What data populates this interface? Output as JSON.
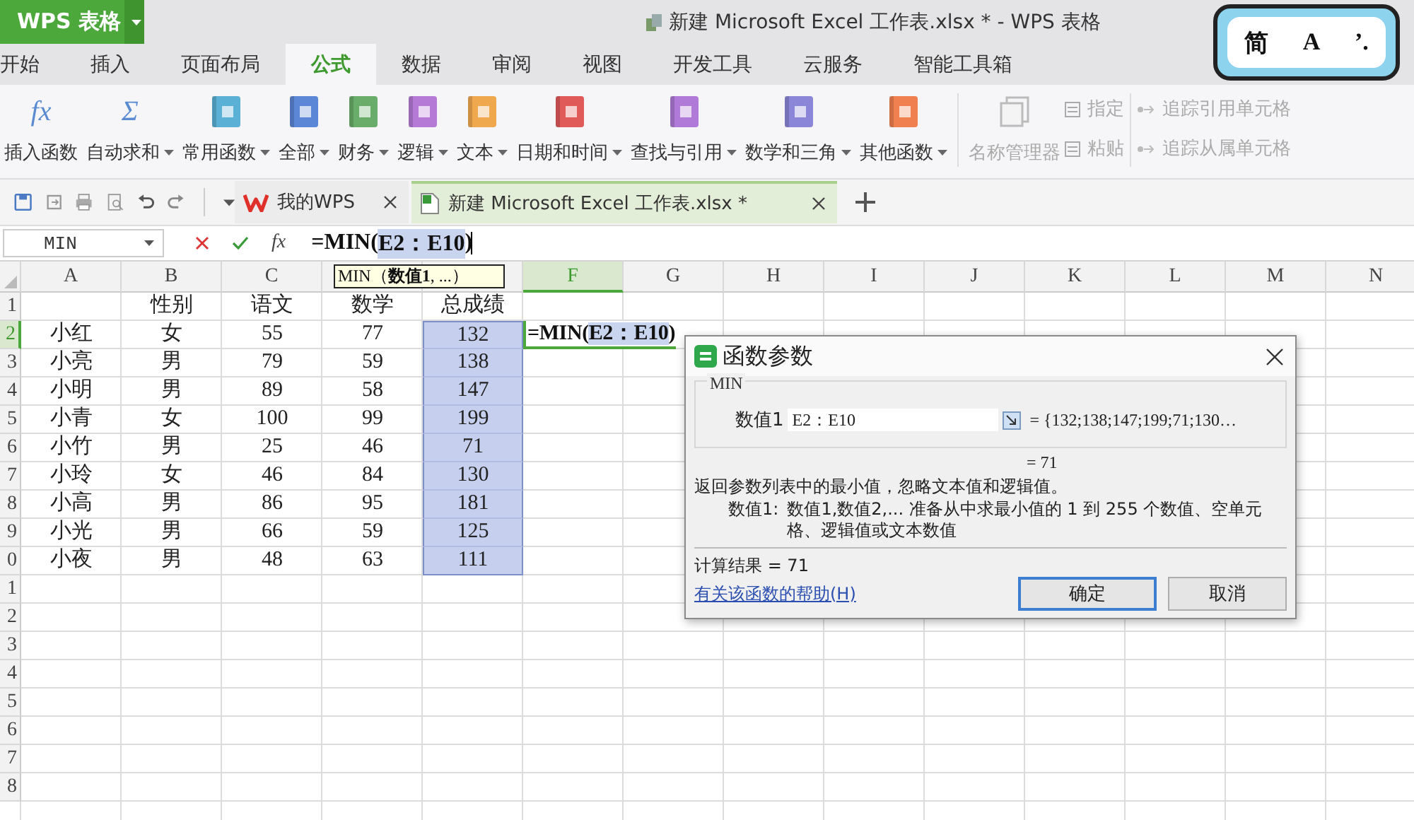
{
  "app_button": {
    "label": "WPS 表格"
  },
  "window": {
    "title": "新建 Microsoft Excel 工作表.xlsx * - WPS 表格"
  },
  "ime_status": {
    "items": [
      "简",
      "A",
      "’."
    ]
  },
  "menu_tabs": [
    {
      "label": "开始",
      "selected": false
    },
    {
      "label": "插入",
      "selected": false
    },
    {
      "label": "页面布局",
      "selected": false
    },
    {
      "label": "公式",
      "selected": true
    },
    {
      "label": "数据",
      "selected": false
    },
    {
      "label": "审阅",
      "selected": false
    },
    {
      "label": "视图",
      "selected": false
    },
    {
      "label": "开发工具",
      "selected": false
    },
    {
      "label": "云服务",
      "selected": false
    },
    {
      "label": "智能工具箱",
      "selected": false
    }
  ],
  "ribbon_buttons": [
    {
      "label": "插入函数",
      "kind": "glyph",
      "glyph": "fx",
      "dropdown": false,
      "disabled": false
    },
    {
      "label": "自动求和",
      "kind": "glyph",
      "glyph": "Σ",
      "dropdown": true,
      "disabled": false
    },
    {
      "label": "常用函数",
      "kind": "book",
      "color": "#5ab0d5",
      "dropdown": true,
      "disabled": false
    },
    {
      "label": "全部",
      "kind": "book",
      "color": "#5b87d6",
      "dropdown": true,
      "disabled": false
    },
    {
      "label": "财务",
      "kind": "book",
      "color": "#6aad6a",
      "dropdown": true,
      "disabled": false
    },
    {
      "label": "逻辑",
      "kind": "book",
      "color": "#b57ad6",
      "dropdown": true,
      "disabled": false
    },
    {
      "label": "文本",
      "kind": "book",
      "color": "#f0a84f",
      "dropdown": true,
      "disabled": false
    },
    {
      "label": "日期和时间",
      "kind": "book",
      "color": "#e05a5a",
      "dropdown": true,
      "disabled": false
    },
    {
      "label": "查找与引用",
      "kind": "book",
      "color": "#b07ad8",
      "dropdown": true,
      "disabled": false
    },
    {
      "label": "数学和三角",
      "kind": "book",
      "color": "#8c86d8",
      "dropdown": true,
      "disabled": false
    },
    {
      "label": "其他函数",
      "kind": "book",
      "color": "#f08050",
      "dropdown": true,
      "disabled": false
    },
    {
      "label": "名称管理器",
      "kind": "sheets",
      "dropdown": false,
      "disabled": true
    }
  ],
  "ribbon_small": [
    {
      "label": "指定",
      "disabled": true
    },
    {
      "label": "粘贴",
      "disabled": true
    }
  ],
  "ribbon_trace": [
    {
      "label": "追踪引用单元格",
      "disabled": true
    },
    {
      "label": "追踪从属单元格",
      "disabled": true
    }
  ],
  "doc_tabs": [
    {
      "label": "我的WPS",
      "kind": "home",
      "selected": false
    },
    {
      "label": "新建 Microsoft Excel 工作表.xlsx *",
      "kind": "sheet",
      "selected": true
    }
  ],
  "formula_bar": {
    "name_box": "MIN",
    "fx": "fx",
    "parts": [
      {
        "text": "=MIN(",
        "highlighted": false
      },
      {
        "text": "E2：E10",
        "highlighted": true
      },
      {
        "text": ")",
        "highlighted": false
      }
    ]
  },
  "tooltip": "MIN（**数值1**, ...）",
  "sheet": {
    "columns": [
      {
        "label": "A",
        "selected": false
      },
      {
        "label": "B",
        "selected": false
      },
      {
        "label": "C",
        "selected": false
      },
      {
        "selected": false
      },
      {
        "selected": false
      },
      {
        "label": "F",
        "selected": true
      },
      {
        "label": "G",
        "selected": false
      },
      {
        "label": "H",
        "selected": false
      },
      {
        "label": "I",
        "selected": false
      },
      {
        "label": "J",
        "selected": false
      },
      {
        "label": "K",
        "selected": false
      },
      {
        "label": "L",
        "selected": false
      },
      {
        "label": "M",
        "selected": false
      },
      {
        "label": "N",
        "selected": false
      }
    ],
    "active_cell": {
      "parts": [
        {
          "text": "=MIN(",
          "highlighted": false
        },
        {
          "text": "E2：E10",
          "highlighted": true
        },
        {
          "text": ")",
          "highlighted": false
        }
      ]
    },
    "rows": [
      {
        "header": "1",
        "selected": false,
        "in_range": false,
        "gender": "性别",
        "chinese": "语文",
        "math": "数学",
        "total": "总成绩"
      },
      {
        "header": "2",
        "selected": true,
        "in_range": true,
        "name": "小红",
        "gender": "女",
        "chinese": "55",
        "math": "77",
        "total": "132"
      },
      {
        "header": "3",
        "selected": false,
        "in_range": true,
        "name": "小亮",
        "gender": "男",
        "chinese": "79",
        "math": "59",
        "total": "138"
      },
      {
        "header": "4",
        "selected": false,
        "in_range": true,
        "name": "小明",
        "gender": "男",
        "chinese": "89",
        "math": "58",
        "total": "147"
      },
      {
        "header": "5",
        "selected": false,
        "in_range": true,
        "name": "小青",
        "gender": "女",
        "chinese": "100",
        "math": "99",
        "total": "199"
      },
      {
        "header": "6",
        "selected": false,
        "in_range": true,
        "name": "小竹",
        "gender": "男",
        "chinese": "25",
        "math": "46",
        "total": "71"
      },
      {
        "header": "7",
        "selected": false,
        "in_range": true,
        "name": "小玲",
        "gender": "女",
        "chinese": "46",
        "math": "84",
        "total": "130"
      },
      {
        "header": "8",
        "selected": false,
        "in_range": true,
        "name": "小高",
        "gender": "男",
        "chinese": "86",
        "math": "95",
        "total": "181"
      },
      {
        "header": "9",
        "selected": false,
        "in_range": true,
        "name": "小光",
        "gender": "男",
        "chinese": "66",
        "math": "59",
        "total": "125"
      },
      {
        "header": "0",
        "selected": false,
        "in_range": true,
        "name": "小夜",
        "gender": "男",
        "chinese": "48",
        "math": "63",
        "total": "111"
      },
      {
        "header": "1",
        "selected": false,
        "in_range": false
      },
      {
        "header": "2",
        "selected": false,
        "in_range": false
      },
      {
        "header": "3",
        "selected": false,
        "in_range": false
      },
      {
        "header": "4",
        "selected": false,
        "in_range": false
      },
      {
        "header": "5",
        "selected": false,
        "in_range": false
      },
      {
        "header": "6",
        "selected": false,
        "in_range": false
      },
      {
        "header": "7",
        "selected": false,
        "in_range": false
      },
      {
        "header": "8",
        "selected": false,
        "in_range": false
      }
    ]
  },
  "dialog": {
    "title": "函数参数",
    "group_label": "MIN",
    "param_label": "数值1",
    "param_value": "E2：E10",
    "param_result": "= {132;138;147;199;71;130…",
    "formula_result": "= 71",
    "description": "返回参数列表中的最小值，忽略文本值和逻辑值。",
    "param_help_label": "数值1:",
    "param_help": "数值1,数值2,... 准备从中求最小值的 1 到 255 个数值、空单元格、逻辑值或文本数值",
    "calc_result": "计算结果 = 71",
    "help_link": "有关该函数的帮助(H)",
    "buttons": [
      {
        "label": "确定",
        "default": true
      },
      {
        "label": "取消",
        "default": false
      }
    ]
  }
}
